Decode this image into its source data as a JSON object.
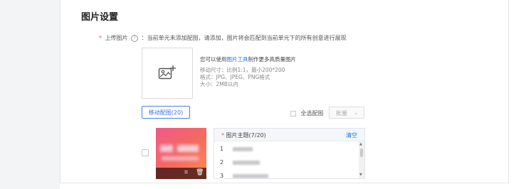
{
  "section": {
    "title": "图片设置"
  },
  "upload": {
    "required_mark": "*",
    "label": "上传图片",
    "help_icon": "question-circle-icon",
    "message": "：当前单元未添加配图，请添加，图片将会匹配到当前单元下的所有创意进行展现"
  },
  "tips": {
    "line1_prefix": "您可以使用",
    "line1_link": "图片工具",
    "line1_suffix": "制作更多高质量图片",
    "size": "移动尺寸：比例1:1，最小200*200",
    "format": "格式：JPG、JPEG、PNG格式",
    "filesize": "大小：2MB以内"
  },
  "toolbar": {
    "move_button": "移动配图(20)",
    "select_all": "全选配图",
    "batch": "批量",
    "batch_icon": "chevron-down-icon"
  },
  "thumbnail": {
    "actions": [
      "crop-icon",
      "delete-icon"
    ]
  },
  "theme_panel": {
    "required_mark": "*",
    "title": "图片主题(7/20)",
    "clear": "清空",
    "rows": [
      {
        "num": "1"
      },
      {
        "num": "2"
      },
      {
        "num": "3"
      }
    ]
  },
  "colors": {
    "accent": "#1a73e8",
    "required": "#ff4d4f"
  }
}
